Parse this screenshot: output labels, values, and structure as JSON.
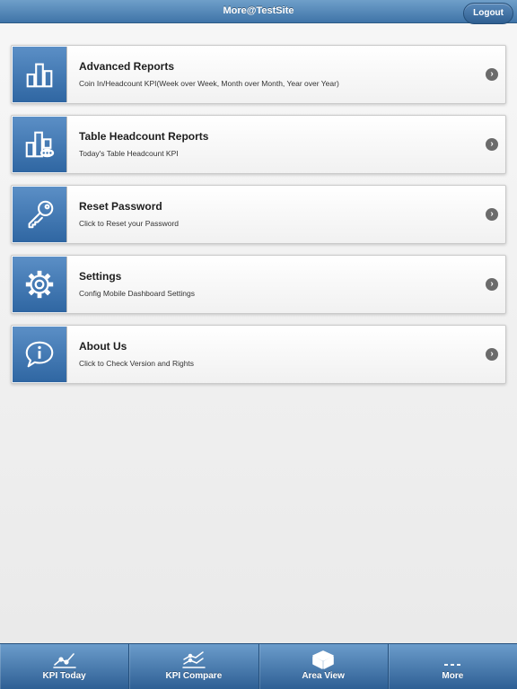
{
  "header": {
    "title": "More@TestSite",
    "logout_label": "Logout"
  },
  "menu": {
    "items": [
      {
        "title": "Advanced Reports",
        "subtitle": "Coin In/Headcount KPI(Week over Week, Month over Month, Year over Year)",
        "icon": "bar-chart-icon"
      },
      {
        "title": "Table Headcount Reports",
        "subtitle": "Today's Table Headcount KPI",
        "icon": "table-chart-icon"
      },
      {
        "title": "Reset Password",
        "subtitle": "Click to Reset your Password",
        "icon": "key-icon"
      },
      {
        "title": "Settings",
        "subtitle": "Config Mobile Dashboard Settings",
        "icon": "gear-icon"
      },
      {
        "title": "About Us",
        "subtitle": "Click to Check Version and Rights",
        "icon": "info-bubble-icon"
      }
    ],
    "chevron_icon": "chevron-right-icon"
  },
  "tabbar": {
    "tabs": [
      {
        "label": "KPI Today",
        "icon": "line-chart-icon"
      },
      {
        "label": "KPI Compare",
        "icon": "compare-chart-icon"
      },
      {
        "label": "Area View",
        "icon": "cube-icon"
      },
      {
        "label": "More",
        "icon": "more-dots-icon"
      }
    ]
  },
  "colors": {
    "header_bg": "#4f82b6",
    "icon_box_bg": "#3f78b4",
    "chevron_bg": "#6b6b6b",
    "page_bg": "#efefef"
  }
}
